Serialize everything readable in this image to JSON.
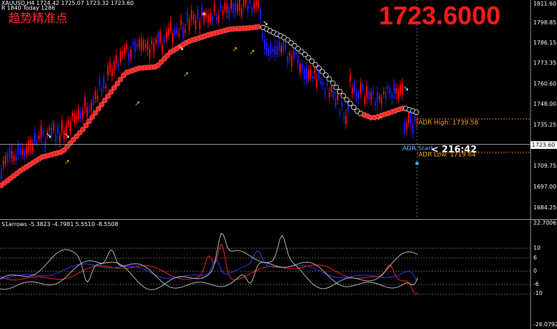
{
  "header": {
    "symbol_line": "XAUUSD,H4  1724.42 1725.07 1723.32 1723.60",
    "sub_line": "R 1840  Today 1286",
    "indicator_title": "趋势精准点"
  },
  "big_price": "1723.6000",
  "adr": {
    "high_label": "ADR High: 1739.58",
    "start_label": "ADR Start",
    "low_label": "ADR Low: 1719.64",
    "timer": "< 216:42"
  },
  "price_axis": {
    "labels": [
      "1811.60",
      "1798.85",
      "1786.15",
      "1773.35",
      "1760.60",
      "1748.00",
      "1735.25",
      "1709.75",
      "1697.00",
      "1684.25"
    ],
    "current": "1723.60"
  },
  "indicator": {
    "label": "S1arrows -5.3823 -4.7981 5.5510 -8.5508",
    "axis_labels": [
      "22.7006",
      "10",
      "6",
      "0",
      "-6",
      "-10",
      "-26.0792"
    ]
  },
  "colors": {
    "bull": "#ff0000",
    "bear": "#1a1aff",
    "band": "#ff2222",
    "band_outline": "#ffffff",
    "arrow_up": "#ffb400",
    "arrow_down": "#ffffff",
    "adr_line": "#ff7a00"
  }
}
